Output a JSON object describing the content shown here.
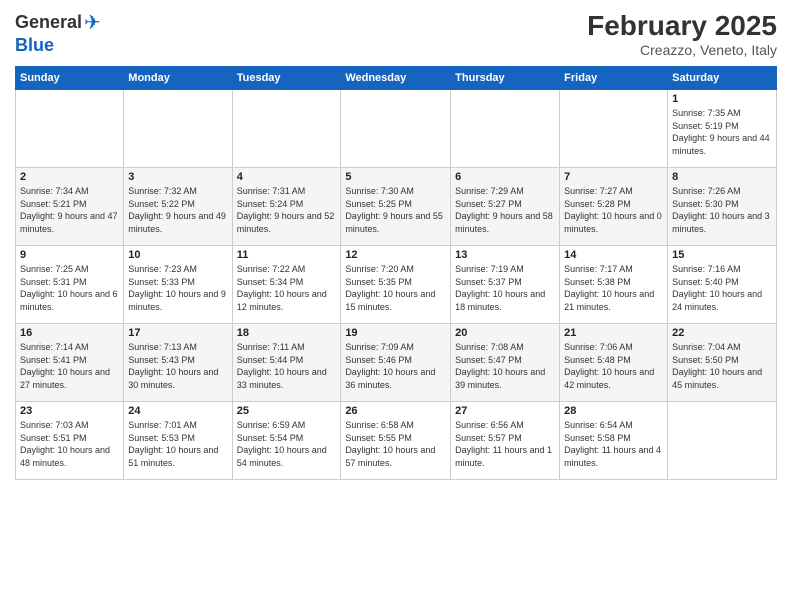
{
  "header": {
    "logo": {
      "general": "General",
      "blue": "Blue"
    },
    "title": "February 2025",
    "location": "Creazzo, Veneto, Italy"
  },
  "weekdays": [
    "Sunday",
    "Monday",
    "Tuesday",
    "Wednesday",
    "Thursday",
    "Friday",
    "Saturday"
  ],
  "weeks": [
    [
      {
        "day": "",
        "info": ""
      },
      {
        "day": "",
        "info": ""
      },
      {
        "day": "",
        "info": ""
      },
      {
        "day": "",
        "info": ""
      },
      {
        "day": "",
        "info": ""
      },
      {
        "day": "",
        "info": ""
      },
      {
        "day": "1",
        "info": "Sunrise: 7:35 AM\nSunset: 5:19 PM\nDaylight: 9 hours\nand 44 minutes."
      }
    ],
    [
      {
        "day": "2",
        "info": "Sunrise: 7:34 AM\nSunset: 5:21 PM\nDaylight: 9 hours\nand 47 minutes."
      },
      {
        "day": "3",
        "info": "Sunrise: 7:32 AM\nSunset: 5:22 PM\nDaylight: 9 hours\nand 49 minutes."
      },
      {
        "day": "4",
        "info": "Sunrise: 7:31 AM\nSunset: 5:24 PM\nDaylight: 9 hours\nand 52 minutes."
      },
      {
        "day": "5",
        "info": "Sunrise: 7:30 AM\nSunset: 5:25 PM\nDaylight: 9 hours\nand 55 minutes."
      },
      {
        "day": "6",
        "info": "Sunrise: 7:29 AM\nSunset: 5:27 PM\nDaylight: 9 hours\nand 58 minutes."
      },
      {
        "day": "7",
        "info": "Sunrise: 7:27 AM\nSunset: 5:28 PM\nDaylight: 10 hours\nand 0 minutes."
      },
      {
        "day": "8",
        "info": "Sunrise: 7:26 AM\nSunset: 5:30 PM\nDaylight: 10 hours\nand 3 minutes."
      }
    ],
    [
      {
        "day": "9",
        "info": "Sunrise: 7:25 AM\nSunset: 5:31 PM\nDaylight: 10 hours\nand 6 minutes."
      },
      {
        "day": "10",
        "info": "Sunrise: 7:23 AM\nSunset: 5:33 PM\nDaylight: 10 hours\nand 9 minutes."
      },
      {
        "day": "11",
        "info": "Sunrise: 7:22 AM\nSunset: 5:34 PM\nDaylight: 10 hours\nand 12 minutes."
      },
      {
        "day": "12",
        "info": "Sunrise: 7:20 AM\nSunset: 5:35 PM\nDaylight: 10 hours\nand 15 minutes."
      },
      {
        "day": "13",
        "info": "Sunrise: 7:19 AM\nSunset: 5:37 PM\nDaylight: 10 hours\nand 18 minutes."
      },
      {
        "day": "14",
        "info": "Sunrise: 7:17 AM\nSunset: 5:38 PM\nDaylight: 10 hours\nand 21 minutes."
      },
      {
        "day": "15",
        "info": "Sunrise: 7:16 AM\nSunset: 5:40 PM\nDaylight: 10 hours\nand 24 minutes."
      }
    ],
    [
      {
        "day": "16",
        "info": "Sunrise: 7:14 AM\nSunset: 5:41 PM\nDaylight: 10 hours\nand 27 minutes."
      },
      {
        "day": "17",
        "info": "Sunrise: 7:13 AM\nSunset: 5:43 PM\nDaylight: 10 hours\nand 30 minutes."
      },
      {
        "day": "18",
        "info": "Sunrise: 7:11 AM\nSunset: 5:44 PM\nDaylight: 10 hours\nand 33 minutes."
      },
      {
        "day": "19",
        "info": "Sunrise: 7:09 AM\nSunset: 5:46 PM\nDaylight: 10 hours\nand 36 minutes."
      },
      {
        "day": "20",
        "info": "Sunrise: 7:08 AM\nSunset: 5:47 PM\nDaylight: 10 hours\nand 39 minutes."
      },
      {
        "day": "21",
        "info": "Sunrise: 7:06 AM\nSunset: 5:48 PM\nDaylight: 10 hours\nand 42 minutes."
      },
      {
        "day": "22",
        "info": "Sunrise: 7:04 AM\nSunset: 5:50 PM\nDaylight: 10 hours\nand 45 minutes."
      }
    ],
    [
      {
        "day": "23",
        "info": "Sunrise: 7:03 AM\nSunset: 5:51 PM\nDaylight: 10 hours\nand 48 minutes."
      },
      {
        "day": "24",
        "info": "Sunrise: 7:01 AM\nSunset: 5:53 PM\nDaylight: 10 hours\nand 51 minutes."
      },
      {
        "day": "25",
        "info": "Sunrise: 6:59 AM\nSunset: 5:54 PM\nDaylight: 10 hours\nand 54 minutes."
      },
      {
        "day": "26",
        "info": "Sunrise: 6:58 AM\nSunset: 5:55 PM\nDaylight: 10 hours\nand 57 minutes."
      },
      {
        "day": "27",
        "info": "Sunrise: 6:56 AM\nSunset: 5:57 PM\nDaylight: 11 hours\nand 1 minute."
      },
      {
        "day": "28",
        "info": "Sunrise: 6:54 AM\nSunset: 5:58 PM\nDaylight: 11 hours\nand 4 minutes."
      },
      {
        "day": "",
        "info": ""
      }
    ]
  ]
}
